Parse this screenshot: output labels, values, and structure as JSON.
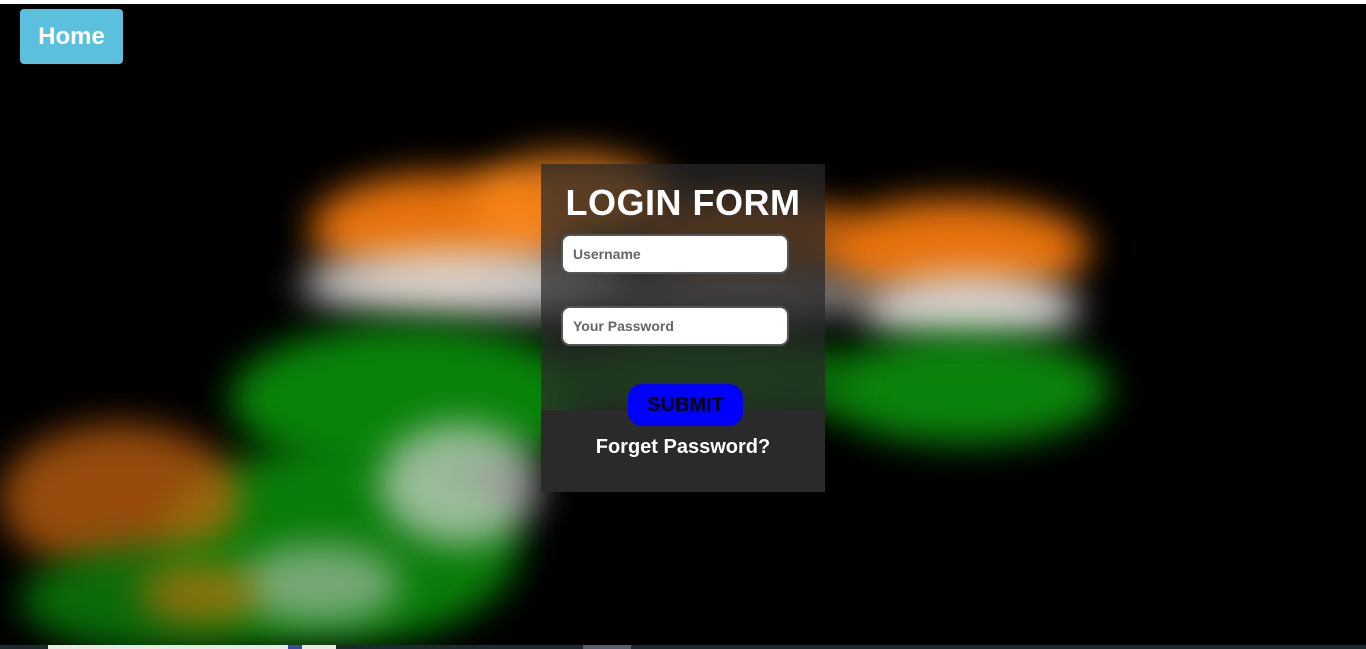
{
  "nav": {
    "home_label": "Home"
  },
  "login": {
    "title": "LOGIN FORM",
    "username_placeholder": "Username",
    "password_placeholder": "Your Password",
    "submit_label": "SUBMIT",
    "forget_label": "Forget Password?"
  },
  "colors": {
    "background": "#000000",
    "home_button": "#5bc0de",
    "submit_button": "#0000ff",
    "saffron": "#ff7f0e",
    "white": "#f0f0f0",
    "green": "#138808"
  }
}
